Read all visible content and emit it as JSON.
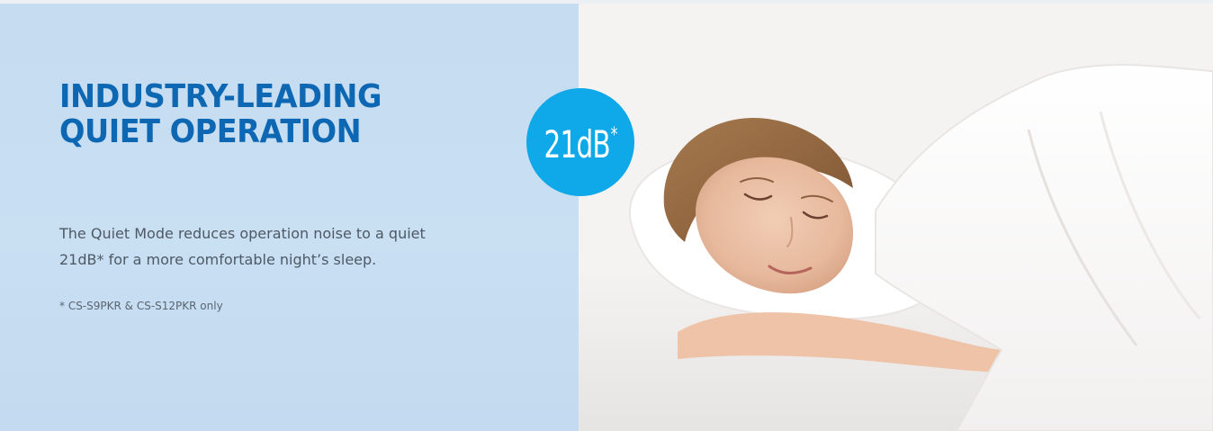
{
  "feature": {
    "headline_line1": "INDUSTRY-LEADING",
    "headline_line2": "QUIET OPERATION",
    "description_line1": "The Quiet Mode reduces operation noise to a quiet",
    "description_line2": "21dB* for a more comfortable night’s sleep.",
    "footnote": "* CS-S9PKR & CS-S12PKR only"
  },
  "badge": {
    "value": "21dB",
    "asterisk": "*"
  },
  "colors": {
    "headline": "#0d67b3",
    "panel_background": "#c5dcf1",
    "badge": "#0fa8e8",
    "body_text": "#4e5965"
  },
  "image": {
    "subject": "sleeping-woman-photo"
  }
}
